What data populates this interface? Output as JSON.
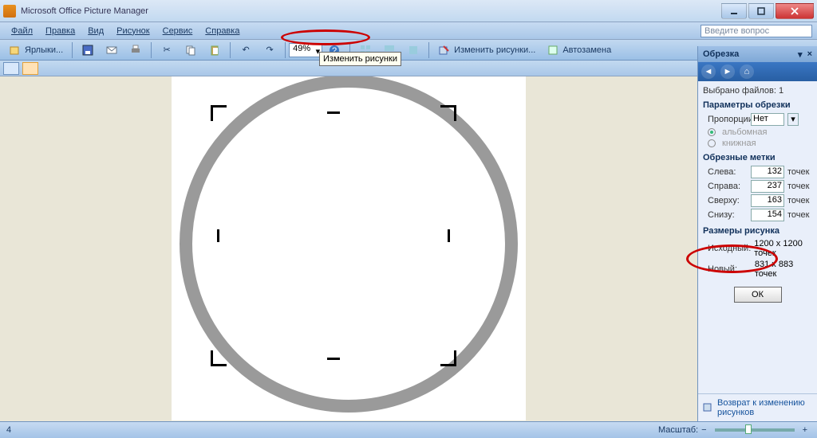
{
  "titlebar": {
    "title": "Microsoft Office Picture Manager"
  },
  "menubar": {
    "items": [
      "Файл",
      "Правка",
      "Вид",
      "Рисунок",
      "Сервис",
      "Справка"
    ],
    "question_placeholder": "Введите вопрос"
  },
  "toolbar": {
    "shortcuts": "Ярлыки...",
    "zoom": "49%",
    "edit_pictures": "Изменить рисунки...",
    "autosubstitution": "Автозамена"
  },
  "tooltip": "Изменить рисунки",
  "taskpane": {
    "title": "Обрезка",
    "selected_files_label": "Выбрано файлов:",
    "selected_files_count": "1",
    "sections": {
      "crop_params": "Параметры обрезки",
      "crop_marks": "Обрезные метки",
      "picture_sizes": "Размеры рисунка"
    },
    "proportions": {
      "label": "Пропорции:",
      "value": "Нет"
    },
    "orientation": {
      "landscape": "альбомная",
      "portrait": "книжная"
    },
    "marks": {
      "left": {
        "label": "Слева:",
        "value": "132",
        "units": "точек"
      },
      "right": {
        "label": "Справа:",
        "value": "237",
        "units": "точек"
      },
      "top": {
        "label": "Сверху:",
        "value": "163",
        "units": "точек"
      },
      "bottom": {
        "label": "Снизу:",
        "value": "154",
        "units": "точек"
      }
    },
    "sizes": {
      "original_label": "Исходный:",
      "original_value": "1200 x 1200 точек",
      "new_label": "Новый:",
      "new_value": "831 x 883 точек"
    },
    "ok": "ОК",
    "return_link": "Возврат к изменению рисунков"
  },
  "statusbar": {
    "page": "4",
    "scale_label": "Масштаб:"
  }
}
